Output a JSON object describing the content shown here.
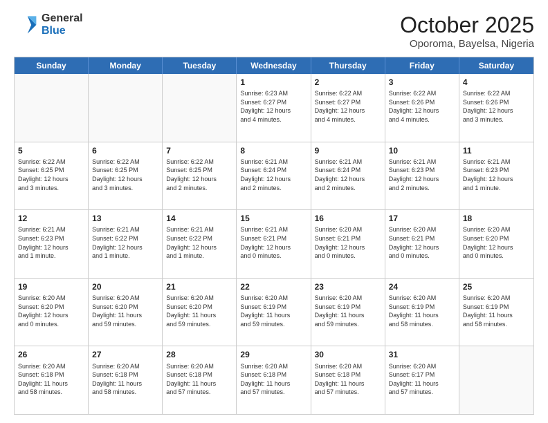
{
  "header": {
    "logo_general": "General",
    "logo_blue": "Blue",
    "month_title": "October 2025",
    "subtitle": "Oporoma, Bayelsa, Nigeria"
  },
  "weekdays": [
    "Sunday",
    "Monday",
    "Tuesday",
    "Wednesday",
    "Thursday",
    "Friday",
    "Saturday"
  ],
  "weeks": [
    [
      {
        "day": "",
        "info": ""
      },
      {
        "day": "",
        "info": ""
      },
      {
        "day": "",
        "info": ""
      },
      {
        "day": "1",
        "info": "Sunrise: 6:23 AM\nSunset: 6:27 PM\nDaylight: 12 hours\nand 4 minutes."
      },
      {
        "day": "2",
        "info": "Sunrise: 6:22 AM\nSunset: 6:27 PM\nDaylight: 12 hours\nand 4 minutes."
      },
      {
        "day": "3",
        "info": "Sunrise: 6:22 AM\nSunset: 6:26 PM\nDaylight: 12 hours\nand 4 minutes."
      },
      {
        "day": "4",
        "info": "Sunrise: 6:22 AM\nSunset: 6:26 PM\nDaylight: 12 hours\nand 3 minutes."
      }
    ],
    [
      {
        "day": "5",
        "info": "Sunrise: 6:22 AM\nSunset: 6:25 PM\nDaylight: 12 hours\nand 3 minutes."
      },
      {
        "day": "6",
        "info": "Sunrise: 6:22 AM\nSunset: 6:25 PM\nDaylight: 12 hours\nand 3 minutes."
      },
      {
        "day": "7",
        "info": "Sunrise: 6:22 AM\nSunset: 6:25 PM\nDaylight: 12 hours\nand 2 minutes."
      },
      {
        "day": "8",
        "info": "Sunrise: 6:21 AM\nSunset: 6:24 PM\nDaylight: 12 hours\nand 2 minutes."
      },
      {
        "day": "9",
        "info": "Sunrise: 6:21 AM\nSunset: 6:24 PM\nDaylight: 12 hours\nand 2 minutes."
      },
      {
        "day": "10",
        "info": "Sunrise: 6:21 AM\nSunset: 6:23 PM\nDaylight: 12 hours\nand 2 minutes."
      },
      {
        "day": "11",
        "info": "Sunrise: 6:21 AM\nSunset: 6:23 PM\nDaylight: 12 hours\nand 1 minute."
      }
    ],
    [
      {
        "day": "12",
        "info": "Sunrise: 6:21 AM\nSunset: 6:23 PM\nDaylight: 12 hours\nand 1 minute."
      },
      {
        "day": "13",
        "info": "Sunrise: 6:21 AM\nSunset: 6:22 PM\nDaylight: 12 hours\nand 1 minute."
      },
      {
        "day": "14",
        "info": "Sunrise: 6:21 AM\nSunset: 6:22 PM\nDaylight: 12 hours\nand 1 minute."
      },
      {
        "day": "15",
        "info": "Sunrise: 6:21 AM\nSunset: 6:21 PM\nDaylight: 12 hours\nand 0 minutes."
      },
      {
        "day": "16",
        "info": "Sunrise: 6:20 AM\nSunset: 6:21 PM\nDaylight: 12 hours\nand 0 minutes."
      },
      {
        "day": "17",
        "info": "Sunrise: 6:20 AM\nSunset: 6:21 PM\nDaylight: 12 hours\nand 0 minutes."
      },
      {
        "day": "18",
        "info": "Sunrise: 6:20 AM\nSunset: 6:20 PM\nDaylight: 12 hours\nand 0 minutes."
      }
    ],
    [
      {
        "day": "19",
        "info": "Sunrise: 6:20 AM\nSunset: 6:20 PM\nDaylight: 12 hours\nand 0 minutes."
      },
      {
        "day": "20",
        "info": "Sunrise: 6:20 AM\nSunset: 6:20 PM\nDaylight: 11 hours\nand 59 minutes."
      },
      {
        "day": "21",
        "info": "Sunrise: 6:20 AM\nSunset: 6:20 PM\nDaylight: 11 hours\nand 59 minutes."
      },
      {
        "day": "22",
        "info": "Sunrise: 6:20 AM\nSunset: 6:19 PM\nDaylight: 11 hours\nand 59 minutes."
      },
      {
        "day": "23",
        "info": "Sunrise: 6:20 AM\nSunset: 6:19 PM\nDaylight: 11 hours\nand 59 minutes."
      },
      {
        "day": "24",
        "info": "Sunrise: 6:20 AM\nSunset: 6:19 PM\nDaylight: 11 hours\nand 58 minutes."
      },
      {
        "day": "25",
        "info": "Sunrise: 6:20 AM\nSunset: 6:19 PM\nDaylight: 11 hours\nand 58 minutes."
      }
    ],
    [
      {
        "day": "26",
        "info": "Sunrise: 6:20 AM\nSunset: 6:18 PM\nDaylight: 11 hours\nand 58 minutes."
      },
      {
        "day": "27",
        "info": "Sunrise: 6:20 AM\nSunset: 6:18 PM\nDaylight: 11 hours\nand 58 minutes."
      },
      {
        "day": "28",
        "info": "Sunrise: 6:20 AM\nSunset: 6:18 PM\nDaylight: 11 hours\nand 57 minutes."
      },
      {
        "day": "29",
        "info": "Sunrise: 6:20 AM\nSunset: 6:18 PM\nDaylight: 11 hours\nand 57 minutes."
      },
      {
        "day": "30",
        "info": "Sunrise: 6:20 AM\nSunset: 6:18 PM\nDaylight: 11 hours\nand 57 minutes."
      },
      {
        "day": "31",
        "info": "Sunrise: 6:20 AM\nSunset: 6:17 PM\nDaylight: 11 hours\nand 57 minutes."
      },
      {
        "day": "",
        "info": ""
      }
    ]
  ]
}
